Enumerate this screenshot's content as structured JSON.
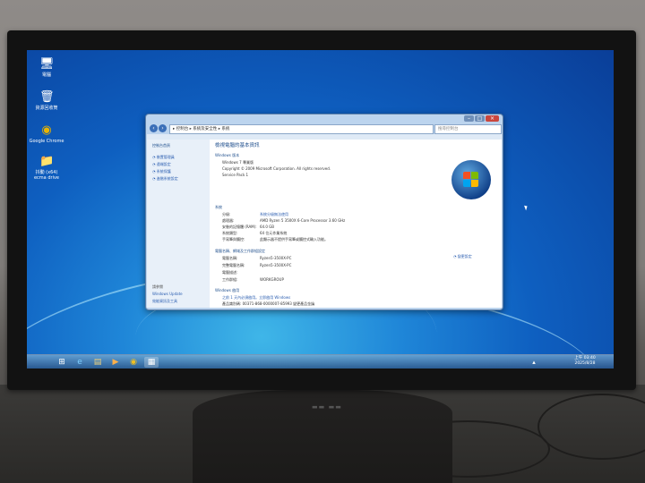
{
  "desktop": {
    "icons": [
      {
        "name": "computer",
        "label": "電腦",
        "glyph": "🖥"
      },
      {
        "name": "recycle-bin",
        "label": "資源回收筒",
        "glyph": "🗑"
      },
      {
        "name": "chrome",
        "label": "Google Chrome",
        "glyph": "◉"
      },
      {
        "name": "folder",
        "label": "抖動 (x64) ecma drive",
        "glyph": "📁"
      }
    ]
  },
  "window": {
    "breadcrumb": "▸ 控制台 ▸ 系統及安全性 ▸ 系統",
    "search_placeholder": "搜尋控制台",
    "sidebar": {
      "home": "控制台首頁",
      "items": [
        "裝置管理員",
        "遠端設定",
        "系統保護",
        "進階系統設定"
      ],
      "see_also": "請參閱",
      "also_items": [
        "Windows Update",
        "效能資訊及工具"
      ]
    },
    "header": "檢視電腦的基本資訊",
    "edition": {
      "heading": "Windows 版本",
      "name": "Windows 7 專業版",
      "copyright": "Copyright © 2009 Microsoft Corporation.  All rights reserved.",
      "sp": "Service Pack 1"
    },
    "system": {
      "heading": "系統",
      "rows": [
        {
          "label": "分級:",
          "value": "系統分級無法使用"
        },
        {
          "label": "處理器:",
          "value": "AMD Ryzen 5 3500X 6-Core Processor       3.60 GHz"
        },
        {
          "label": "安裝的記憶體 (RAM):",
          "value": "64.0 GB"
        },
        {
          "label": "系統類型:",
          "value": "64 位元作業系統"
        },
        {
          "label": "手寫筆與觸控:",
          "value": "此顯示器不提供手寫筆或觸控式輸入功能。"
        }
      ]
    },
    "computer": {
      "heading": "電腦名稱、網域及工作群組設定",
      "change_link": "變更設定",
      "rows": [
        {
          "label": "電腦名稱:",
          "value": "Ryzen5-3500X-PC"
        },
        {
          "label": "完整電腦名稱:",
          "value": "Ryzen5-3500X-PC"
        },
        {
          "label": "電腦描述:",
          "value": ""
        },
        {
          "label": "工作群組:",
          "value": "WORKGROUP"
        }
      ]
    },
    "activation": {
      "heading": "Windows 啟用",
      "status": "之前 1 天內必須啟用。立即啟用 Windows",
      "product_id": "產品識別碼: 00371-868-0000007-85993  變更產品金鑰"
    }
  },
  "taskbar": {
    "time": "上午 03:40",
    "date": "2025/8/28",
    "buttons": [
      {
        "name": "start-button",
        "glyph": "⊞"
      },
      {
        "name": "ie-button",
        "glyph": "e"
      },
      {
        "name": "explorer-button",
        "glyph": "▤"
      },
      {
        "name": "media-button",
        "glyph": "▶"
      },
      {
        "name": "chrome-taskbar-button",
        "glyph": "◉"
      },
      {
        "name": "control-panel-taskbar-button",
        "glyph": "▦"
      }
    ]
  },
  "colors": {
    "accent": "#1e4e8c",
    "desktop": "#0e5fc0",
    "link": "#2a5db0"
  }
}
